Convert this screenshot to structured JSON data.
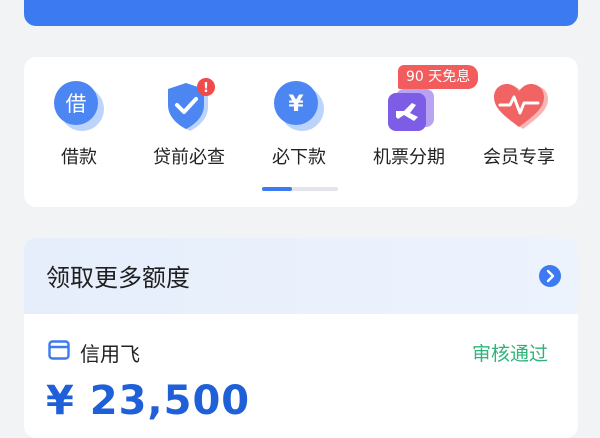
{
  "quick_actions": [
    {
      "label": "借款",
      "icon": "borrow-icon",
      "glyph": "借"
    },
    {
      "label": "贷前必查",
      "icon": "shield-check-icon",
      "alert": "!"
    },
    {
      "label": "必下款",
      "icon": "yen-icon",
      "glyph": "¥"
    },
    {
      "label": "机票分期",
      "icon": "plane-icon"
    },
    {
      "label": "会员专享",
      "icon": "heart-pulse-icon"
    }
  ],
  "promo_tag": "90 天免息",
  "carousel": {
    "pages": 2,
    "active": 1
  },
  "quota": {
    "title": "领取更多额度",
    "product_name": "信用飞",
    "status": "审核通过",
    "amount": "¥ 23,500"
  },
  "colors": {
    "accent": "#3b7af0",
    "success": "#2fb37a",
    "alert": "#f25c5c",
    "amount": "#1f5fd8"
  }
}
